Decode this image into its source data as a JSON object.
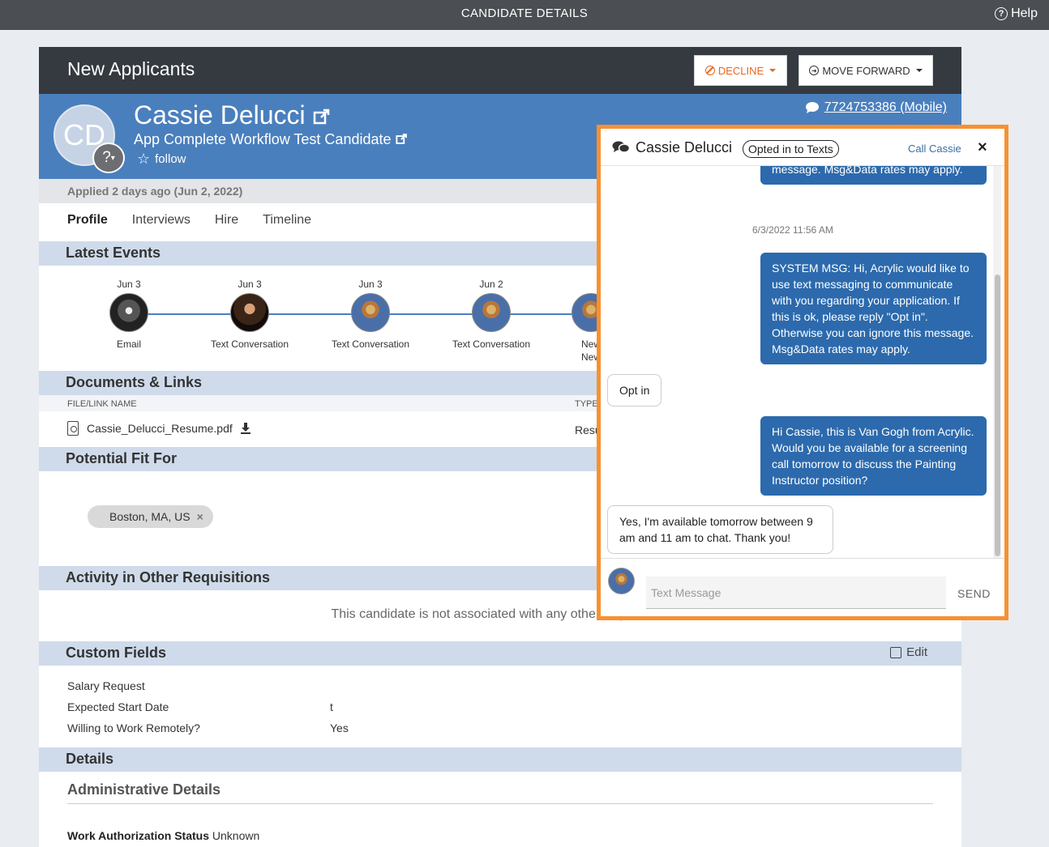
{
  "topbar": {
    "title": "CANDIDATE DETAILS",
    "help": "Help"
  },
  "card": {
    "stage": "New Applicants",
    "decline_label": "DECLINE",
    "forward_label": "MOVE FORWARD"
  },
  "candidate": {
    "initials": "CD",
    "badge": "?",
    "name": "Cassie Delucci",
    "requisition": "App Complete Workflow Test Candidate",
    "follow": "follow",
    "phone": "7724753386 (Mobile)",
    "applied": "Applied 2 days ago (Jun 2, 2022)"
  },
  "tabs": [
    "Profile",
    "Interviews",
    "Hire",
    "Timeline"
  ],
  "sections": {
    "latest_events": "Latest Events",
    "documents": "Documents & Links",
    "potential_fit": "Potential Fit For",
    "activity": "Activity in Other Requisitions",
    "custom_fields": "Custom Fields",
    "details": "Details"
  },
  "events": [
    {
      "date": "Jun 3",
      "label": "Email"
    },
    {
      "date": "Jun 3",
      "label": "Text Conversation"
    },
    {
      "date": "Jun 3",
      "label": "Text Conversation"
    },
    {
      "date": "Jun 2",
      "label": "Text Conversation"
    },
    {
      "date": "",
      "label": "New"
    }
  ],
  "event_overflow": "New",
  "documents": {
    "col_name": "FILE/LINK NAME",
    "col_type": "TYPE",
    "file": "Cassie_Delucci_Resume.pdf",
    "type": "Resu"
  },
  "potential_fit": {
    "tag": "Boston, MA, US",
    "remove": "×"
  },
  "activity": {
    "message": "This candidate is not associated with any other requisitions"
  },
  "custom_fields": {
    "edit": "Edit",
    "rows": [
      {
        "label": "Salary Request",
        "value": ""
      },
      {
        "label": "Expected Start Date",
        "value": "t"
      },
      {
        "label": "Willing to Work Remotely?",
        "value": "Yes"
      }
    ]
  },
  "details": {
    "admin_title": "Administrative Details",
    "work_auth_label": "Work Authorization Status",
    "work_auth_value": "Unknown"
  },
  "chat": {
    "name": "Cassie Delucci",
    "status": "Opted in to Texts",
    "call": "Call Cassie",
    "close": "×",
    "partial_top": "message. Msg&Data rates may apply.",
    "timestamp": "6/3/2022 11:56 AM",
    "messages": [
      "SYSTEM MSG: Hi, Acrylic would like to use text messaging to communicate with you regarding your application. If this is ok, please reply \"Opt in\". Otherwise you can ignore this message. Msg&Data rates may apply.",
      "Opt in",
      "Hi Cassie, this is Van Gogh from Acrylic. Would you be available for a screening call tomorrow to discuss the Painting Instructor position?",
      "Yes, I'm available tomorrow between 9 am and 11 am to chat. Thank you!"
    ],
    "placeholder": "Text Message",
    "send": "SEND"
  }
}
